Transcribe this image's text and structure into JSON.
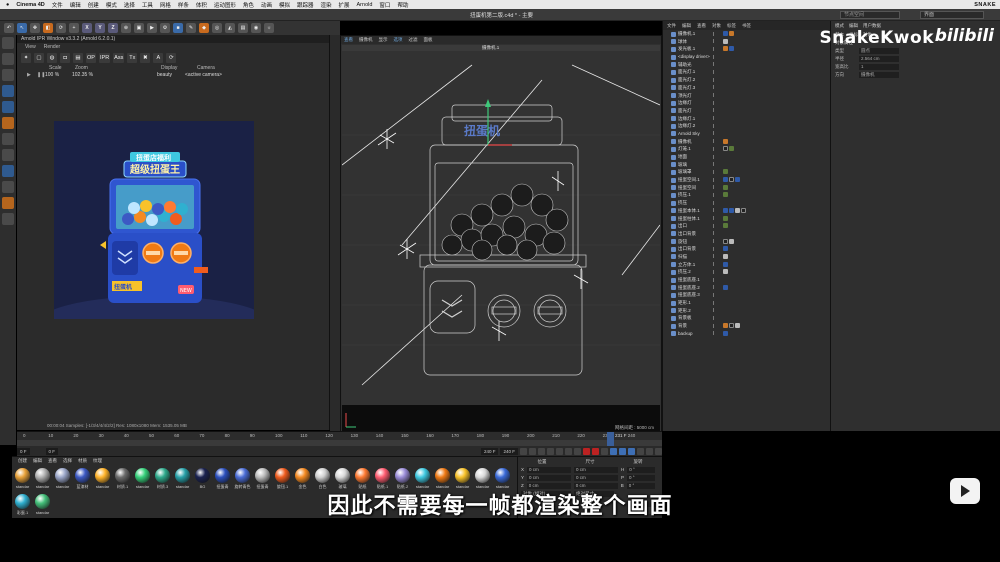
{
  "menubar": {
    "apple": "",
    "app": "Cinema 4D",
    "items": [
      "文件",
      "编辑",
      "创建",
      "模式",
      "选择",
      "工具",
      "网格",
      "样条",
      "体积",
      "运动图形",
      "角色",
      "动画",
      "模拟",
      "跟踪器",
      "渲染",
      "扩展",
      "Arnold",
      "窗口",
      "帮助"
    ],
    "brand": "SNAKE"
  },
  "titlebar": {
    "document": "扭蛋机第二版.c4d * - 主要",
    "search_placeholder": "节点空间",
    "layout": "界面"
  },
  "ipr": {
    "title": "Arnold IPR Window v3.3.2 (Arnold 6.2.0.1)",
    "menu": [
      "View",
      "Render"
    ],
    "tools": [
      "OP",
      "IPR",
      "Ass",
      "Tx"
    ],
    "labels": {
      "scale": "Scale",
      "zoom": "Zoom",
      "display": "Display",
      "camera": "Camera"
    },
    "values": {
      "scale": "100 %",
      "zoom": "102.35 %",
      "display": "beauty",
      "camera": "<active camera>"
    },
    "status": "00:00:04  Samples: [-1/3/4/4/4/2/2]  Res: 1080x1080  Mem: 1535.05 MB",
    "render_text": {
      "badge": "扭蛋店福利",
      "title": "超级扭蛋王",
      "coin": "NEW",
      "bottom": "扭蛋机"
    }
  },
  "viewport": {
    "menu": [
      "查看",
      "摄像机",
      "显示",
      "选项",
      "过滤",
      "面板"
    ],
    "camera_label": "摄像机.1",
    "sign_text": "扭蛋机",
    "status": "网格间距 : 5000 cm",
    "top_label": "透视视图"
  },
  "object_manager": {
    "tabs": [
      "文件",
      "编辑",
      "查看",
      "对象",
      "标签",
      "书签"
    ],
    "objects": [
      {
        "name": "摄像机.1",
        "tags": [
          "b",
          "o"
        ]
      },
      {
        "name": "球体",
        "tags": [
          "w"
        ]
      },
      {
        "name": "发光板.1",
        "tags": [
          "o",
          "b"
        ]
      },
      {
        "name": "<display driver>",
        "tags": []
      },
      {
        "name": "辅助光",
        "tags": []
      },
      {
        "name": "面光灯.1",
        "tags": []
      },
      {
        "name": "面光灯.2",
        "tags": []
      },
      {
        "name": "面光灯.3",
        "tags": []
      },
      {
        "name": "顶光灯",
        "tags": []
      },
      {
        "name": "边缘灯",
        "tags": []
      },
      {
        "name": "面光灯",
        "tags": []
      },
      {
        "name": "边缘灯.1",
        "tags": []
      },
      {
        "name": "边缘灯.2",
        "tags": []
      },
      {
        "name": "Arnold Sky",
        "tags": []
      },
      {
        "name": "摄像机",
        "tags": [
          "o"
        ]
      },
      {
        "name": "灯笼.1",
        "tags": [
          "k",
          "g"
        ]
      },
      {
        "name": "地面",
        "tags": []
      },
      {
        "name": "玻璃",
        "tags": []
      },
      {
        "name": "玻璃罩",
        "tags": [
          "g"
        ]
      },
      {
        "name": "扭蛋空间.1",
        "tags": [
          "b",
          "k",
          "b"
        ]
      },
      {
        "name": "扭蛋空间",
        "tags": [
          "g"
        ]
      },
      {
        "name": "挤压.1",
        "tags": [
          "g"
        ]
      },
      {
        "name": "挤压",
        "tags": []
      },
      {
        "name": "扭蛋本体.1",
        "tags": [
          "b",
          "b",
          "w",
          "k"
        ]
      },
      {
        "name": "扭蛋柱体.1",
        "tags": [
          "g"
        ]
      },
      {
        "name": "出口",
        "tags": [
          "g"
        ]
      },
      {
        "name": "出口背景",
        "tags": []
      },
      {
        "name": "旋钮",
        "tags": [
          "k",
          "w"
        ]
      },
      {
        "name": "出口背景",
        "tags": [
          "b"
        ]
      },
      {
        "name": "扫描",
        "tags": [
          "w"
        ]
      },
      {
        "name": "立方体.1",
        "tags": [
          "b"
        ]
      },
      {
        "name": "挤压.2",
        "tags": [
          "w"
        ]
      },
      {
        "name": "扭蛋底座.1",
        "tags": []
      },
      {
        "name": "扭蛋底座.2",
        "tags": [
          "b"
        ]
      },
      {
        "name": "扭蛋底座.3",
        "tags": []
      },
      {
        "name": "矩形.1",
        "tags": []
      },
      {
        "name": "矩形.2",
        "tags": []
      },
      {
        "name": "背景板",
        "tags": []
      },
      {
        "name": "背景",
        "tags": [
          "o",
          "k",
          "w"
        ]
      },
      {
        "name": "backup",
        "tags": [
          "b"
        ]
      }
    ]
  },
  "attributes": {
    "tabs": [
      "模式",
      "编辑",
      "用户数据"
    ],
    "section": "对象属性",
    "subtabs": [
      "基本",
      "坐标",
      "对象"
    ],
    "rows": [
      {
        "label": "类型",
        "value": "圆点"
      },
      {
        "label": "半径",
        "value": "2.564 cm"
      },
      {
        "label": "宽高比",
        "value": "1"
      },
      {
        "label": "方向",
        "value": "摄像机"
      }
    ]
  },
  "watermark": {
    "text": "SnakeKwok",
    "logo": "bilibili"
  },
  "timeline": {
    "ticks": [
      "0",
      "10",
      "20",
      "30",
      "40",
      "50",
      "60",
      "70",
      "80",
      "90",
      "100",
      "110",
      "120",
      "130",
      "140",
      "150",
      "160",
      "170",
      "180",
      "190",
      "200",
      "210",
      "220",
      "230",
      "240"
    ],
    "current": "231 F",
    "cursor_frame": "231"
  },
  "transport": {
    "start": "0 F",
    "min": "0 F",
    "max": "240 F",
    "end": "240 F"
  },
  "material_manager": {
    "menu": [
      "创建",
      "编辑",
      "查看",
      "选择",
      "材质",
      "纹理"
    ],
    "materials": [
      {
        "label": "standar",
        "color": "#e8a23a"
      },
      {
        "label": "standar",
        "color": "#b0b0b0"
      },
      {
        "label": "standar",
        "color": "#9aa6c9"
      },
      {
        "label": "蓝漆材",
        "color": "#3c59c4"
      },
      {
        "label": "standar",
        "color": "#ffb32a"
      },
      {
        "label": "材质.1",
        "color": "#6c6c6c"
      },
      {
        "label": "standar",
        "color": "#35d07a"
      },
      {
        "label": "材质.3",
        "color": "#2eaa8c"
      },
      {
        "label": "standar",
        "color": "#26a0a8"
      },
      {
        "label": "BG",
        "color": "#1a2250"
      },
      {
        "label": "扭蛋青",
        "color": "#2b4fbd"
      },
      {
        "label": "旋转青色",
        "color": "#4a6cd6"
      },
      {
        "label": "扭蛋青",
        "color": "#bbbbbb"
      },
      {
        "label": "旋钮.1",
        "color": "#f05c1e"
      },
      {
        "label": "金色",
        "color": "#f58a22"
      },
      {
        "label": "白色",
        "color": "#cfcfcf"
      },
      {
        "label": "玻璃",
        "color": "#d8d8d8"
      },
      {
        "label": "贴纸",
        "color": "#ff7a32"
      },
      {
        "label": "贴纸.1",
        "color": "#ff5c70"
      },
      {
        "label": "贴纸.2",
        "color": "#9a8cd8"
      },
      {
        "label": "standar",
        "color": "#3ec8e0"
      },
      {
        "label": "standar",
        "color": "#f07a14"
      },
      {
        "label": "standar",
        "color": "#f8c22a"
      },
      {
        "label": "standar",
        "color": "#d8d8d8"
      },
      {
        "label": "standar",
        "color": "#3a6ad8"
      },
      {
        "label": "彩蛋.1",
        "color": "#2fb0d0"
      },
      {
        "label": "standar",
        "color": "#44c07a"
      }
    ]
  },
  "coordinates": {
    "headers": [
      "位置",
      "尺寸",
      "旋转"
    ],
    "rows": [
      {
        "axis": "X",
        "pos": "0 cm",
        "size": "0 cm",
        "rot_axis": "H",
        "rot": "0 °"
      },
      {
        "axis": "Y",
        "pos": "0 cm",
        "size": "0 cm",
        "rot_axis": "P",
        "rot": "0 °"
      },
      {
        "axis": "Z",
        "pos": "0 cm",
        "size": "0 cm",
        "rot_axis": "B",
        "rot": "0 °"
      }
    ],
    "mode": "对象 (相对)",
    "size_mode": "绝对尺寸",
    "apply": "应用"
  },
  "subtitle": "因此不需要每一帧都渲染整个画面",
  "colors": {
    "accent": "#3a6aa8",
    "render_bg": "#171d3a",
    "machine_blue": "#2a4fc8",
    "orange": "#f07a14"
  }
}
